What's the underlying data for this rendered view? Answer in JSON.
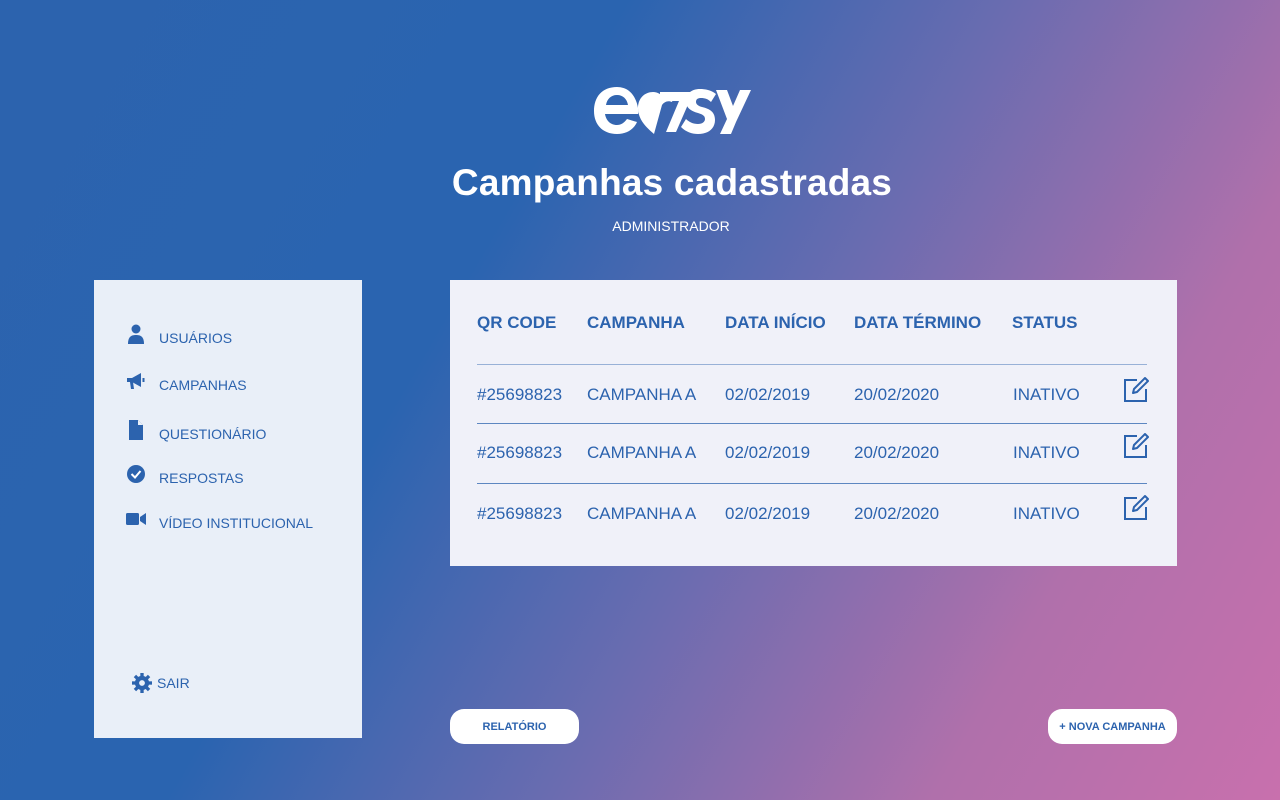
{
  "brand": {
    "logo_text": "easy",
    "color": "#ffffff"
  },
  "header": {
    "title": "Campanhas cadastradas",
    "subtitle": "ADMINISTRADOR"
  },
  "sidebar": {
    "items": [
      {
        "label": "USUÁRIOS",
        "icon": "user-icon"
      },
      {
        "label": "CAMPANHAS",
        "icon": "megaphone-icon"
      },
      {
        "label": "QUESTIONÁRIO",
        "icon": "document-icon"
      },
      {
        "label": "RESPOSTAS",
        "icon": "check-circle-icon"
      },
      {
        "label": "VÍDEO INSTITUCIONAL",
        "icon": "video-camera-icon"
      }
    ],
    "logout": {
      "label": "SAIR",
      "icon": "gear-icon"
    }
  },
  "table": {
    "headers": [
      "QR CODE",
      "CAMPANHA",
      "DATA INÍCIO",
      "DATA TÉRMINO",
      "STATUS"
    ],
    "rows": [
      [
        "#25698823",
        "CAMPANHA A",
        "02/02/2019",
        "20/02/2020",
        "INATIVO"
      ],
      [
        "#25698823",
        "CAMPANHA A",
        "02/02/2019",
        "20/02/2020",
        "INATIVO"
      ],
      [
        "#25698823",
        "CAMPANHA A",
        "02/02/2019",
        "20/02/2020",
        "INATIVO"
      ]
    ],
    "row_action_icon": "edit-icon"
  },
  "actions": {
    "report_label": "RELATÓRIO",
    "new_campaign_label": "+ NOVA CAMPANHA"
  },
  "colors": {
    "accent": "#2c63ae",
    "sidebar_bg": "#e9eff8",
    "panel_bg": "#f0f1f9",
    "gradient_start": "#2a64b0",
    "gradient_end": "#c870ad"
  }
}
